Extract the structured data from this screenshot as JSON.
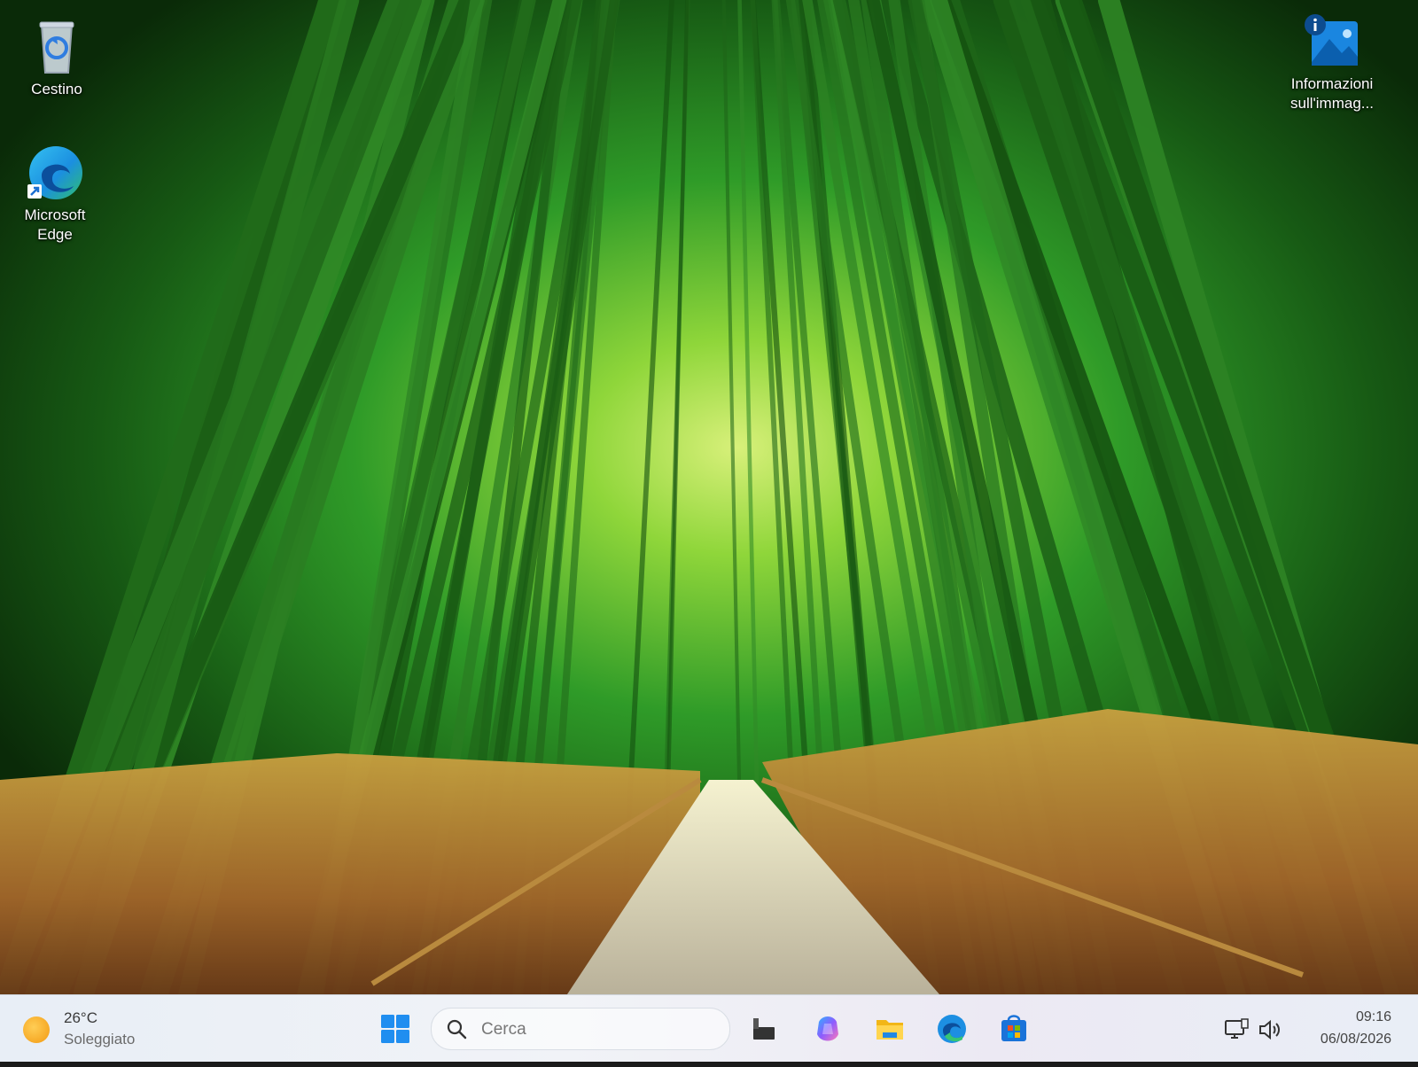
{
  "desktop": {
    "icons": [
      {
        "label": "Cestino",
        "icon": "recycle-bin-icon"
      },
      {
        "label_line1": "Microsoft",
        "label_line2": "Edge",
        "icon": "edge-icon"
      },
      {
        "label_line1": "Informazioni",
        "label_line2": "sull'immag...",
        "icon": "image-info-icon"
      }
    ]
  },
  "taskbar": {
    "weather": {
      "temp": "26°C",
      "condition": "Soleggiato"
    },
    "search": {
      "placeholder": "Cerca"
    },
    "apps": [
      "start-icon",
      "task-view-icon",
      "copilot-icon",
      "file-explorer-icon",
      "edge-icon",
      "store-icon"
    ],
    "tray": [
      "network-icon",
      "volume-icon"
    ],
    "clock": {
      "time": "09:16",
      "date": "06/08/2026"
    }
  },
  "colors": {
    "accent": "#0078d4",
    "taskbar_bg": "#eef1f6",
    "wallpaper_green": "#2e9a2a"
  }
}
